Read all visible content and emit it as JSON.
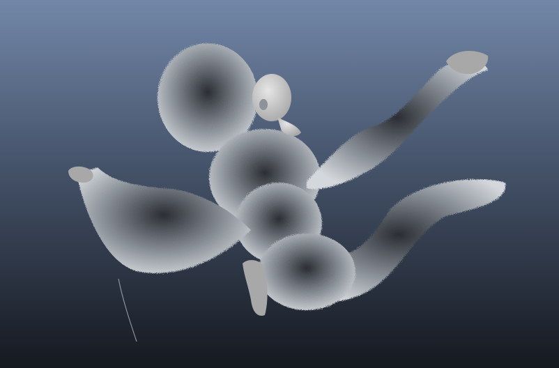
{
  "viewport": {
    "background_top_color": "#7287a8",
    "background_mid_color": "#45536a",
    "background_bottom_color": "#151920"
  },
  "render": {
    "subject": "fur-covered-humanoid-figure",
    "fur_light_color": "#d4d8dc",
    "fur_mid_color": "#8d939b",
    "fur_dark_color": "#2a2e34",
    "skin_color": "#a8a8a8",
    "skin_highlight_color": "#e6e6e6"
  }
}
